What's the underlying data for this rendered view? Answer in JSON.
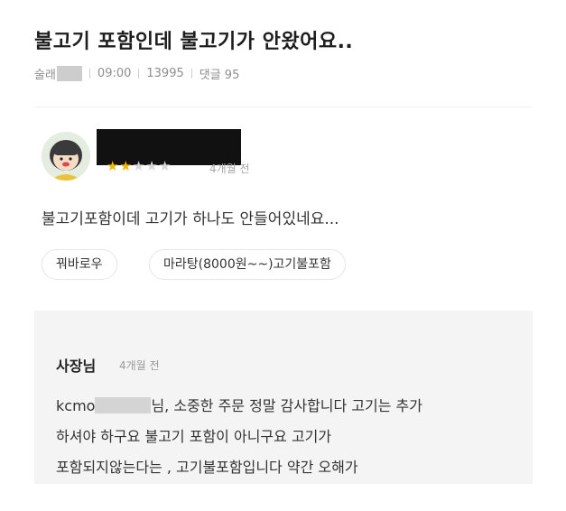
{
  "post": {
    "title": "불고기 포함인데 불고기가 안왔어요..",
    "author_prefix": "술래",
    "time": "09:00",
    "views": "13995",
    "comments": "댓글 95"
  },
  "review": {
    "rating": 2,
    "max_rating": 5,
    "date": "4개월 전",
    "text": "불고기포함이데 고기가 하나도 안들어있네요...",
    "tags": [
      "꿔바로우",
      "마라탕(8000원~~)고기불포함"
    ]
  },
  "reply": {
    "author": "사장님",
    "date": "4개월 전",
    "line1_prefix": "kcmo",
    "line1_suffix": "님, 소중한 주문 정말 감사합니다  고기는 추가",
    "line2": "하셔야 하구요 불고기 포함이 아니구요 고기가",
    "line3": "포함되지않는다는 , 고기불포함입니다 약간 오해가"
  },
  "colors": {
    "star_on": "#f2b705",
    "star_off": "#d8d8d8",
    "reply_bg": "#f4f4f4"
  }
}
